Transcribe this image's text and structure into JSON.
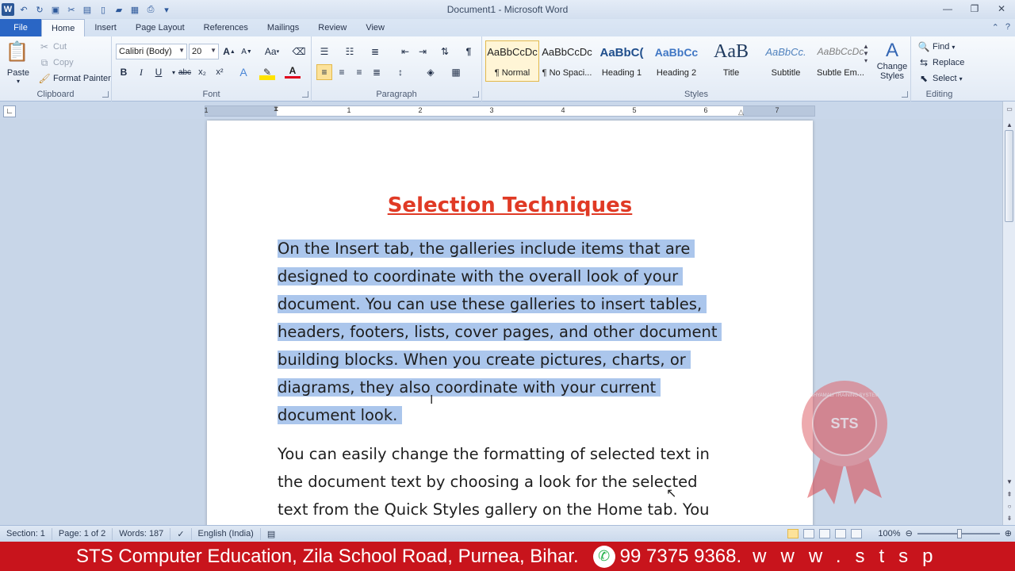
{
  "window": {
    "title": "Document1  -  Microsoft Word",
    "app_icon": "word-logo",
    "qat_icons": [
      "undo-icon",
      "redo-icon",
      "save-icon",
      "print-icon",
      "new-icon",
      "open-icon"
    ],
    "controls": [
      "minimize-icon",
      "restore-icon",
      "close-icon"
    ]
  },
  "tabs": [
    {
      "label": "File"
    },
    {
      "label": "Home"
    },
    {
      "label": "Insert"
    },
    {
      "label": "Page Layout"
    },
    {
      "label": "References"
    },
    {
      "label": "Mailings"
    },
    {
      "label": "Review"
    },
    {
      "label": "View"
    }
  ],
  "ribbon": {
    "clipboard": {
      "label": "Clipboard",
      "paste": "Paste",
      "cut": "Cut",
      "copy": "Copy",
      "format_painter": "Format Painter"
    },
    "font": {
      "label": "Font",
      "font_name": "Calibri (Body)",
      "font_size": "20",
      "buttons": {
        "bold": "B",
        "italic": "I",
        "underline": "U",
        "strike": "abc",
        "subscript": "x₂",
        "superscript": "x²"
      },
      "grow": "A",
      "shrink": "A",
      "case": "Aa"
    },
    "paragraph": {
      "label": "Paragraph",
      "show_marks": "¶"
    },
    "styles": {
      "label": "Styles",
      "items": [
        {
          "sample": "AaBbCcDc",
          "name": "¶ Normal"
        },
        {
          "sample": "AaBbCcDc",
          "name": "¶ No Spaci..."
        },
        {
          "sample": "AaBbC(",
          "name": "Heading 1"
        },
        {
          "sample": "AaBbCc",
          "name": "Heading 2"
        },
        {
          "sample": "AaB",
          "name": "Title"
        },
        {
          "sample": "AaBbCc.",
          "name": "Subtitle"
        },
        {
          "sample": "AaBbCcDc",
          "name": "Subtle Em..."
        }
      ],
      "change_styles": "Change Styles"
    },
    "editing": {
      "label": "Editing",
      "find": "Find",
      "replace": "Replace",
      "select": "Select"
    }
  },
  "ruler": {
    "numbers": [
      "1",
      "1",
      "2",
      "3",
      "4",
      "5",
      "6",
      "7"
    ]
  },
  "document": {
    "title": "Selection Techniques",
    "paragraph1": [
      "On the Insert tab, the galleries include items that are",
      "designed to coordinate with the overall look of your",
      "document. You can use these galleries to insert tables,",
      "headers, footers, lists, cover pages, and other document",
      "building blocks. When you create pictures, charts, or",
      "diagrams, they also coordinate with your current",
      "document look."
    ],
    "paragraph2": [
      "You can easily change the formatting of selected text in",
      "the document text by choosing a look for the selected",
      "text from the Quick Styles gallery on the Home tab. You"
    ]
  },
  "statusbar": {
    "section": "Section: 1",
    "page": "Page: 1 of 2",
    "words": "Words: 187",
    "language": "English (India)",
    "zoom": "100%"
  },
  "banner": {
    "text": "STS Computer Education, Zila School Road, Purnea, Bihar.",
    "phone": "99 7375 9368.",
    "url": "www.stsp"
  },
  "watermark": {
    "text": "STS",
    "ring_text": "SHYAMALI TRAINING SYSTEM"
  }
}
